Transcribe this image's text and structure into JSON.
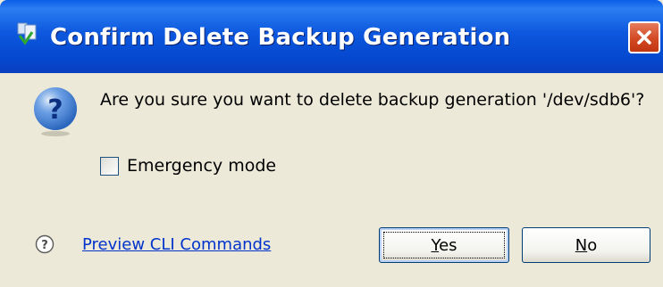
{
  "dialog": {
    "title": "Confirm Delete Backup Generation",
    "message": "Are you sure you want to delete backup generation '/dev/sdb6'?",
    "emergency_mode": {
      "label": "Emergency mode",
      "checked": false
    },
    "preview_link": "Preview CLI Commands",
    "yes_label": "Yes",
    "no_label": "No"
  },
  "icons": {
    "app": "app-icon",
    "close": "close-icon",
    "question": "question-icon",
    "help": "help-icon"
  },
  "colors": {
    "titlebar": "#0a5ee8",
    "close": "#d24a24",
    "window_bg": "#ece9d8",
    "link": "#0033cc",
    "button_border": "#003c74"
  }
}
